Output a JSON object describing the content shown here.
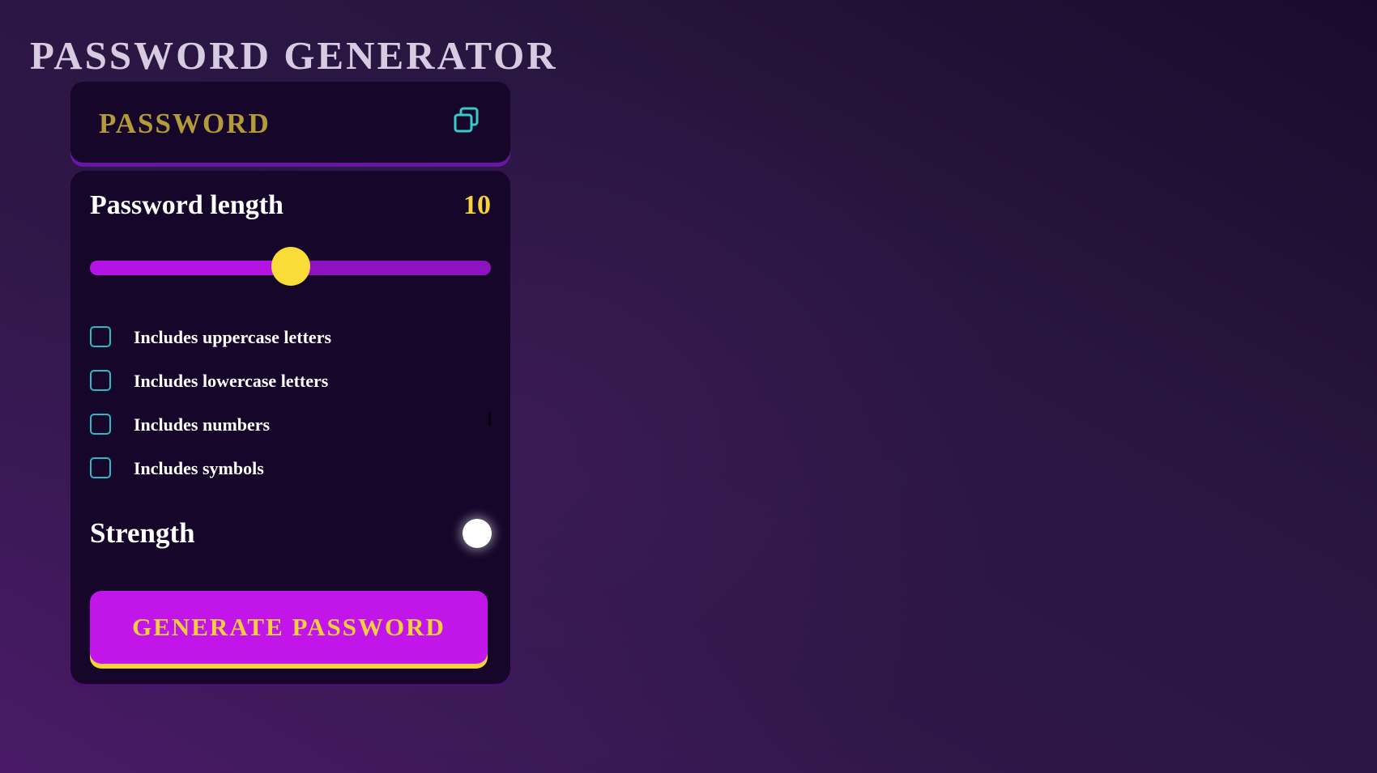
{
  "app": {
    "title": "PASSWORD GENERATOR"
  },
  "display": {
    "password_text": "PASSWORD",
    "copy_icon": "copy-icon"
  },
  "length": {
    "label": "Password length",
    "value": "10",
    "slider_fraction": 0.5
  },
  "options": [
    {
      "label": "Includes uppercase letters",
      "checked": false
    },
    {
      "label": "Includes lowercase letters",
      "checked": false
    },
    {
      "label": "Includes numbers",
      "checked": false
    },
    {
      "label": "Includes symbols",
      "checked": false
    }
  ],
  "strength": {
    "label": "Strength",
    "indicator_color": "#ffffff"
  },
  "actions": {
    "generate_label": "GENERATE PASSWORD"
  },
  "colors": {
    "accent_purple": "#c115ea",
    "accent_yellow": "#f5d33c",
    "checkbox_border": "#2bbbc4",
    "card_background": "#16072a"
  }
}
